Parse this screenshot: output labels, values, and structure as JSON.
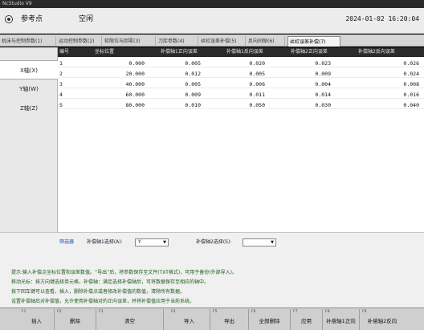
{
  "window": {
    "title": "NcStudio V9"
  },
  "header": {
    "title": "参考点",
    "mode": "空闲",
    "datetime": "2024-01-02 16:20:04"
  },
  "tabs": [
    {
      "label": "机床与控制参数(1)",
      "active": false
    },
    {
      "label": "运动控制参数(2)",
      "active": false
    },
    {
      "label": "软限位与回零(3)",
      "active": false
    },
    {
      "label": "刀库参数(4)",
      "active": false
    },
    {
      "label": "丝杠误差补偿(5)",
      "active": false
    },
    {
      "label": "反向间隙(6)",
      "active": false
    },
    {
      "label": "丝杠误差补偿(7)",
      "active": true
    }
  ],
  "sidebar": {
    "items": [
      {
        "label": "X轴(X)",
        "active": true
      },
      {
        "label": "Y轴(W)",
        "active": false
      },
      {
        "label": "Z轴(Z)",
        "active": false
      }
    ]
  },
  "table": {
    "columns": [
      "编号",
      "坐标位置",
      "补偿轴1正向误差",
      "补偿轴1反向误差",
      "补偿轴2正向误差",
      "补偿轴2反向误差"
    ],
    "rows": [
      {
        "no": "1",
        "pos": "0.000",
        "a1p": "0.005",
        "a1n": "0.020",
        "a2p": "0.023",
        "a2n": "0.026"
      },
      {
        "no": "2",
        "pos": "20.000",
        "a1p": "0.012",
        "a1n": "0.005",
        "a2p": "0.009",
        "a2n": "0.024"
      },
      {
        "no": "3",
        "pos": "40.000",
        "a1p": "0.005",
        "a1n": "0.006",
        "a2p": "0.004",
        "a2n": "0.008"
      },
      {
        "no": "4",
        "pos": "60.000",
        "a1p": "0.009",
        "a1n": "0.011",
        "a2p": "0.014",
        "a2n": "0.016"
      },
      {
        "no": "5",
        "pos": "80.000",
        "a1p": "0.010",
        "a1n": "0.050",
        "a2p": "0.030",
        "a2n": "0.040"
      }
    ]
  },
  "filter": {
    "label": "筛选器",
    "axis1_label": "补偿轴1选择(A):",
    "axis1_value": "Y",
    "axis2_label": "补偿轴2选择(S):",
    "axis2_value": ""
  },
  "info": {
    "lines": [
      "提示:输入补偿点坐标位置和误差数值。“导出”后，将参数保存至文件(TXT格式)，可用于备份(外部导入)。",
      "移动光标：按方向键选择单元格，补偿轴：满足选择补偿轴后，可将数据保存至相应的轴中。",
      "按下回车键可以查看，插入，删除补偿点或者修改补偿值的数值，清除所有数据。",
      "设置补偿轴后对补偿值，允许使用补偿轴对的正向误差，并将补偿值应用于当前系统。"
    ]
  },
  "fkeys": [
    {
      "key": "F1",
      "label": "插入"
    },
    {
      "key": "F2",
      "label": "删除"
    },
    {
      "key": "F3",
      "label": "清空"
    },
    {
      "key": "F4",
      "label": "导入"
    },
    {
      "key": "F5",
      "label": "导出"
    },
    {
      "key": "F6",
      "label": "全部删除"
    },
    {
      "key": "F7",
      "label": "应用"
    },
    {
      "key": "F8",
      "label": "补偿轴1正向"
    },
    {
      "key": "F9",
      "label": "补偿轴2反向"
    }
  ]
}
